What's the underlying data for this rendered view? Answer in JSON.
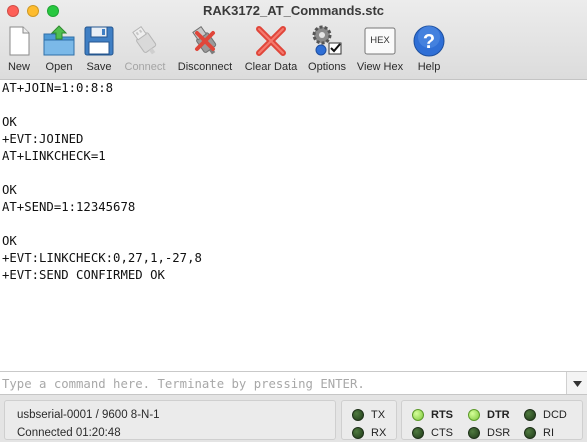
{
  "window": {
    "title": "RAK3172_AT_Commands.stc"
  },
  "toolbar": {
    "new": "New",
    "open": "Open",
    "save": "Save",
    "connect": "Connect",
    "disconnect": "Disconnect",
    "clear_data": "Clear Data",
    "options": "Options",
    "view_hex": "View Hex",
    "help": "Help",
    "hex_badge": "HEX"
  },
  "terminal": {
    "lines": [
      "AT+JOIN=1:0:8:8",
      "",
      "OK",
      "+EVT:JOINED",
      "AT+LINKCHECK=1",
      "",
      "OK",
      "AT+SEND=1:12345678",
      "",
      "OK",
      "+EVT:LINKCHECK:0,27,1,-27,8",
      "+EVT:SEND CONFIRMED OK"
    ]
  },
  "command": {
    "placeholder": "Type a command here. Terminate by pressing ENTER.",
    "value": ""
  },
  "status": {
    "port": "usbserial-0001 / 9600 8-N-1",
    "connected": "Connected 01:20:48",
    "tx": "TX",
    "rx": "RX",
    "rts": "RTS",
    "cts": "CTS",
    "dtr": "DTR",
    "dsr": "DSR",
    "dcd": "DCD",
    "ri": "RI",
    "leds": {
      "tx": false,
      "rx": false,
      "rts": true,
      "cts": false,
      "dtr": true,
      "dsr": false,
      "dcd": false,
      "ri": false
    }
  },
  "colors": {
    "close": "#fe5f57",
    "minimize": "#febc2e",
    "zoom": "#28c840",
    "led_on": "#7cc63a",
    "led_off": "#2b4a24",
    "help_blue": "#2f6fd6",
    "disconnect_red": "#e0463a"
  }
}
